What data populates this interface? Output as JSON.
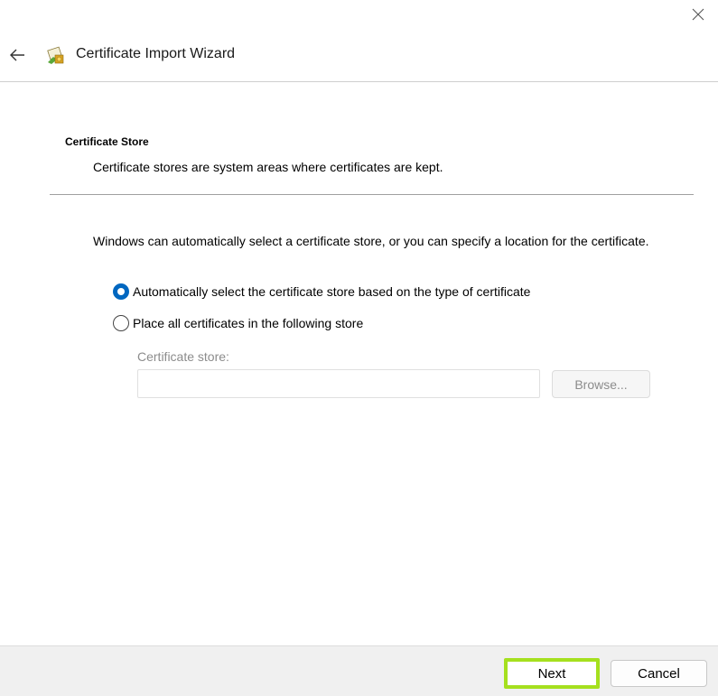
{
  "window": {
    "title": "Certificate Import Wizard",
    "close_icon": "close-icon",
    "back_icon": "back-arrow-icon",
    "wizard_icon": "certificate-icon"
  },
  "section": {
    "title": "Certificate Store",
    "description": "Certificate stores are system areas where certificates are kept."
  },
  "body": {
    "intro": "Windows can automatically select a certificate store, or you can specify a location for the certificate.",
    "options": [
      {
        "label": "Automatically select the certificate store based on the type of certificate",
        "selected": true
      },
      {
        "label": "Place all certificates in the following store",
        "selected": false
      }
    ],
    "store_label": "Certificate store:",
    "store_value": "",
    "browse_label": "Browse..."
  },
  "footer": {
    "next_label": "Next",
    "cancel_label": "Cancel"
  },
  "colors": {
    "accent": "#0067c0",
    "focus_highlight": "#a5e01e",
    "footer_bg": "#f0f0f0",
    "disabled_text": "#8c8c8c"
  }
}
